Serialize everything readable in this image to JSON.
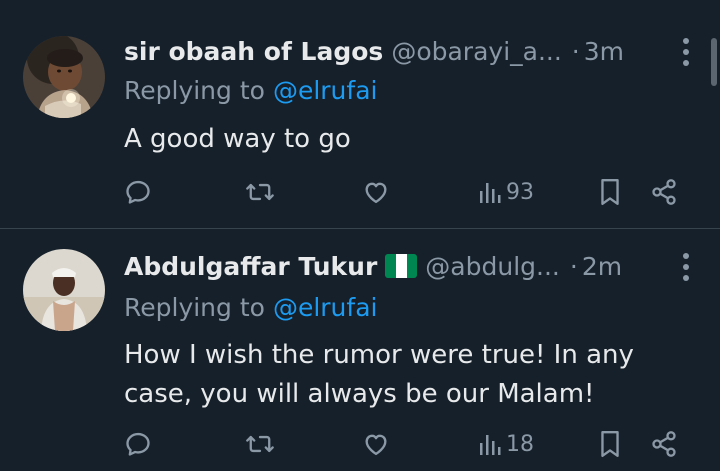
{
  "tweets": [
    {
      "name": "sir obaah of Lagos",
      "handle": "@obarayi_a...",
      "dot": "·",
      "time": "3m",
      "replying_label": "Replying to",
      "replying_to": "@elrufai",
      "text": "A good way to go",
      "views": "93",
      "icons": [
        "reply-icon",
        "retweet-icon",
        "like-icon",
        "views-icon",
        "bookmark-icon",
        "share-icon",
        "more-icon"
      ]
    },
    {
      "name": "Abdulgaffar Tukur",
      "flag": "nigeria-flag",
      "handle": "@abdulg...",
      "dot": "·",
      "time": "2m",
      "replying_label": "Replying to",
      "replying_to": "@elrufai",
      "text": "How I wish the rumor were true! In any case, you will always be our Malam!",
      "views": "18",
      "icons": [
        "reply-icon",
        "retweet-icon",
        "like-icon",
        "views-icon",
        "bookmark-icon",
        "share-icon",
        "more-icon"
      ]
    }
  ],
  "colors": {
    "background": "#15202b",
    "text": "#e7e9ea",
    "muted": "#8b98a5",
    "link": "#1d9bf0",
    "divider": "#38444d",
    "flag_green": "#008751",
    "flag_white": "#ffffff"
  }
}
